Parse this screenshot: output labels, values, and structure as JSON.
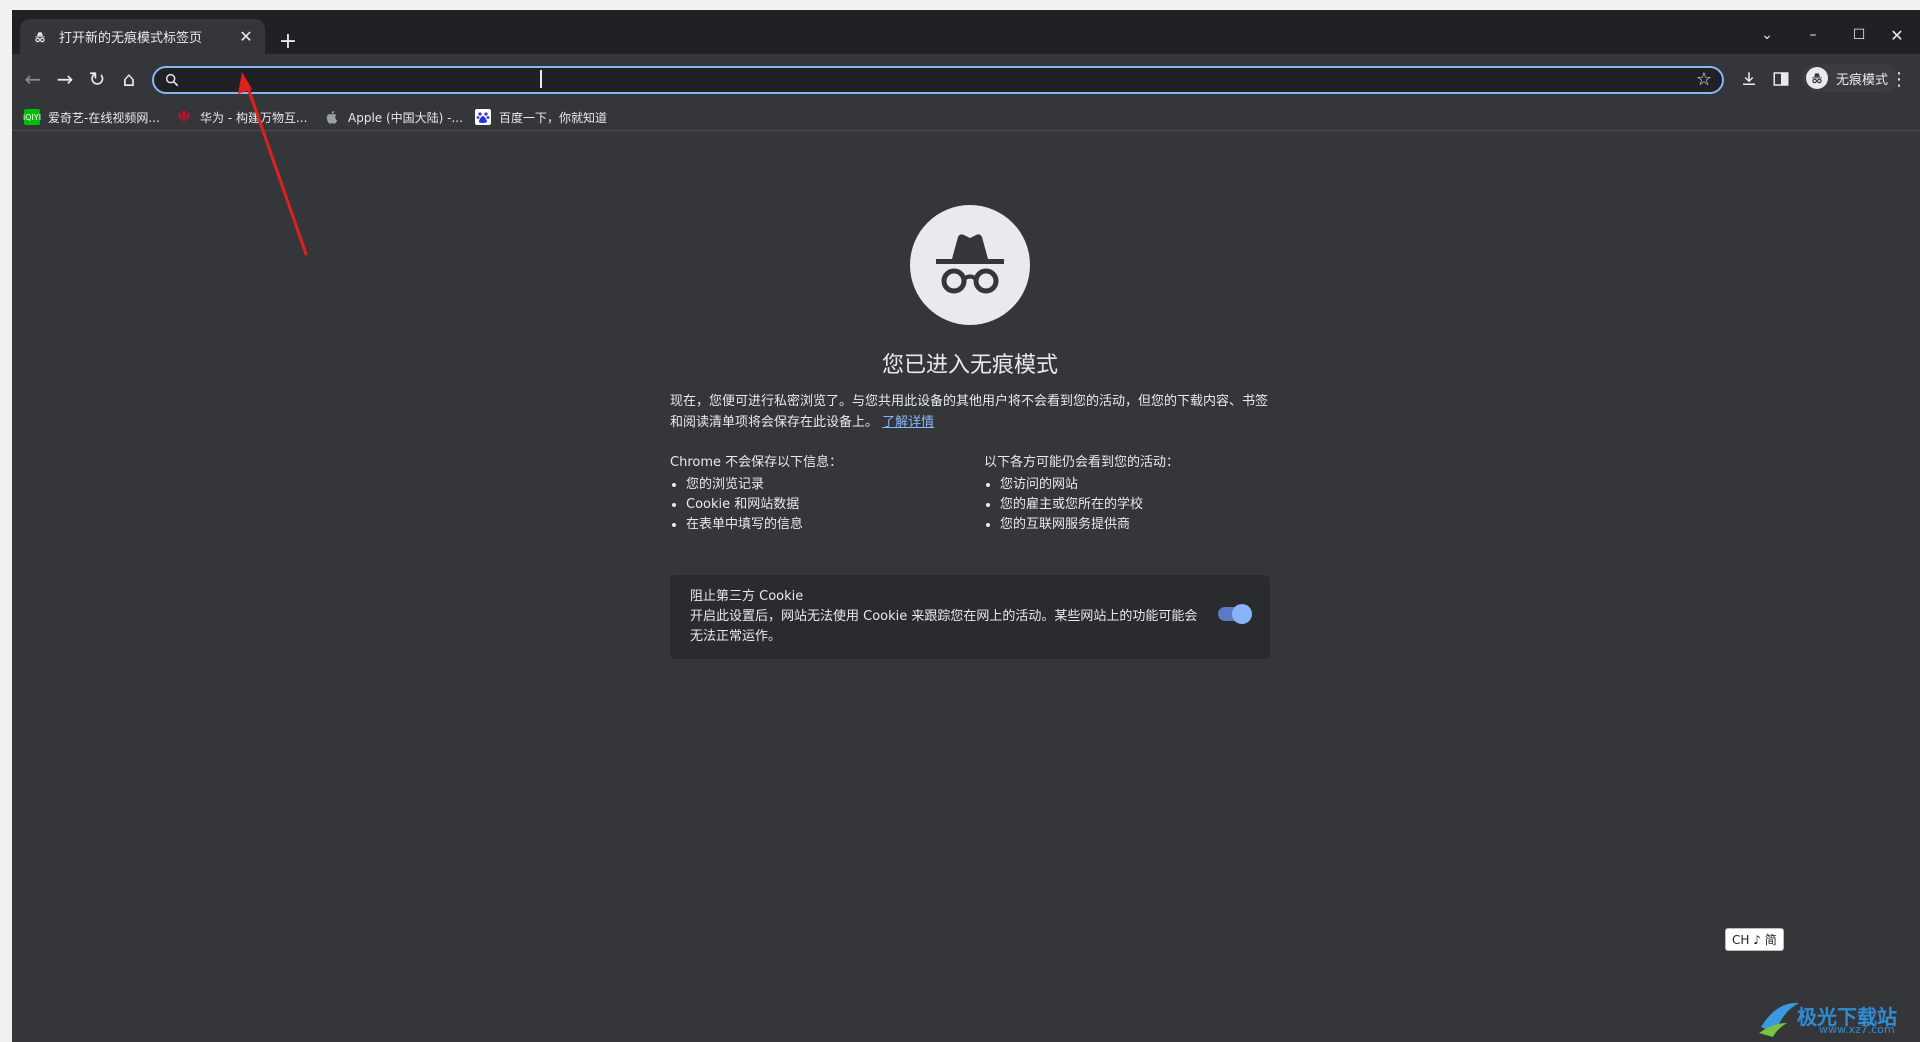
{
  "tab": {
    "title": "打开新的无痕模式标签页",
    "close": "✕"
  },
  "new_tab": "+",
  "window_controls": {
    "tab_search": "⌄",
    "minimize": "–",
    "maximize": "☐",
    "close": "✕"
  },
  "toolbar": {
    "back": "←",
    "forward": "→",
    "reload": "↻",
    "home": "⌂"
  },
  "omnibox": {
    "value": "",
    "placeholder": ""
  },
  "incognito_chip": {
    "label": "无痕模式"
  },
  "bookmarks": [
    {
      "label": "爱奇艺-在线视频网...",
      "icon": "iqiyi-icon",
      "color": "#00be06",
      "badge": "iQIYI"
    },
    {
      "label": "华为 - 构建万物互...",
      "icon": "huawei-icon",
      "color": "#cf0a2c",
      "badge": ""
    },
    {
      "label": "Apple (中国大陆) -...",
      "icon": "apple-icon",
      "color": "#9aa0a6",
      "badge": ""
    },
    {
      "label": "百度一下，你就知道",
      "icon": "baidu-icon",
      "color": "#2932e1",
      "badge": ""
    }
  ],
  "page": {
    "headline": "您已进入无痕模式",
    "intro": "现在，您便可进行私密浏览了。与您共用此设备的其他用户将不会看到您的活动，但您的下载内容、书签和阅读清单项将会保存在此设备上。",
    "learn_more": "了解详情",
    "not_saved": {
      "title": "Chrome 不会保存以下信息：",
      "items": [
        "您的浏览记录",
        "Cookie 和网站数据",
        "在表单中填写的信息"
      ]
    },
    "still_visible": {
      "title": "以下各方可能仍会看到您的活动：",
      "items": [
        "您访问的网站",
        "您的雇主或您所在的学校",
        "您的互联网服务提供商"
      ]
    },
    "cookie_card": {
      "title": "阻止第三方 Cookie",
      "description": "开启此设置后，网站无法使用 Cookie 来跟踪您在网上的活动。某些网站上的功能可能会无法正常运作。",
      "toggle_on": true
    }
  },
  "ime_indicator": "CH ♪ 简",
  "watermark": {
    "text": "极光下载站",
    "sub": "www.xz7.com"
  },
  "colors": {
    "accent": "#8ab4f8",
    "background": "#35363a",
    "tabstrip": "#202124",
    "annotation_arrow": "#e0201c"
  }
}
